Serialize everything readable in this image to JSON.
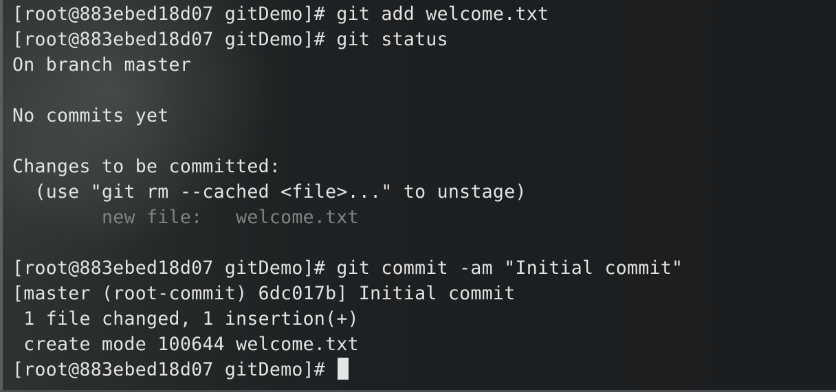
{
  "terminal": {
    "lines": [
      {
        "text": "[root@883ebed18d07 gitDemo]# git add welcome.txt",
        "style": "normal"
      },
      {
        "text": "[root@883ebed18d07 gitDemo]# git status",
        "style": "normal"
      },
      {
        "text": "On branch master",
        "style": "normal"
      },
      {
        "text": "",
        "style": "normal"
      },
      {
        "text": "No commits yet",
        "style": "normal"
      },
      {
        "text": "",
        "style": "normal"
      },
      {
        "text": "Changes to be committed:",
        "style": "normal"
      },
      {
        "text": "  (use \"git rm --cached <file>...\" to unstage)",
        "style": "normal"
      },
      {
        "text": "        new file:   welcome.txt",
        "style": "staged"
      },
      {
        "text": "",
        "style": "normal"
      },
      {
        "text": "[root@883ebed18d07 gitDemo]# git commit -am \"Initial commit\"",
        "style": "normal"
      },
      {
        "text": "[master (root-commit) 6dc017b] Initial commit",
        "style": "normal"
      },
      {
        "text": " 1 file changed, 1 insertion(+)",
        "style": "normal"
      },
      {
        "text": " create mode 100644 welcome.txt",
        "style": "normal"
      }
    ],
    "prompt": "[root@883ebed18d07 gitDemo]# ",
    "colors": {
      "foreground": "#e2e4e3",
      "staged": "#7f8483",
      "background": "#1b1e20",
      "cursor": "#e4e6e5"
    }
  }
}
